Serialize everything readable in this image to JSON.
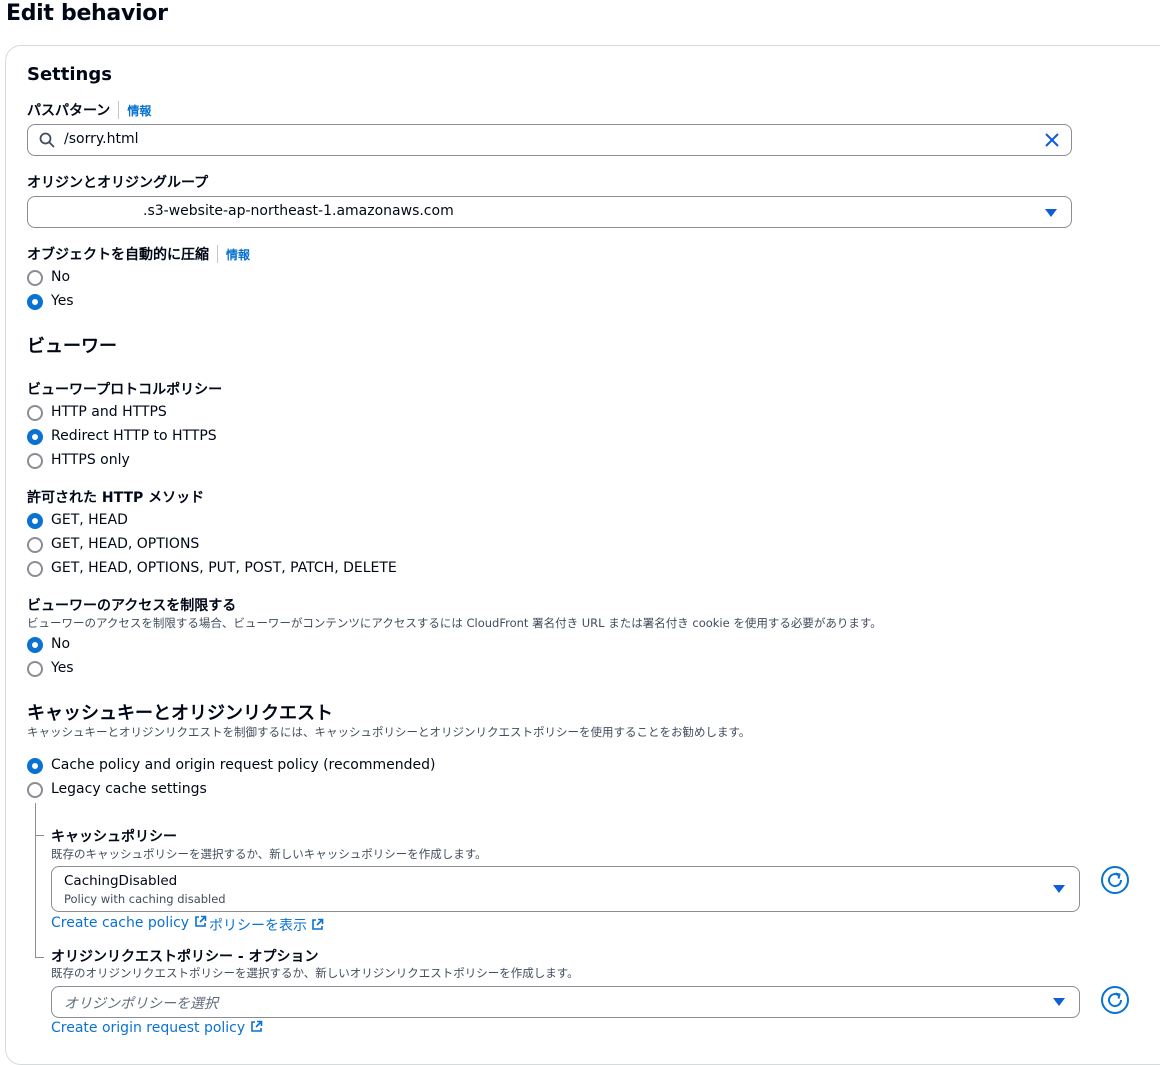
{
  "page_title": "Edit behavior",
  "settings": {
    "heading": "Settings",
    "path_pattern": {
      "label": "パスパターン",
      "info": "情報",
      "value": "/sorry.html"
    },
    "origin": {
      "label": "オリジンとオリジングループ",
      "value": ".s3-website-ap-northeast-1.amazonaws.com"
    },
    "compress": {
      "label": "オブジェクトを自動的に圧縮",
      "info": "情報",
      "options": [
        "No",
        "Yes"
      ],
      "selected": "Yes"
    }
  },
  "viewer": {
    "heading": "ビューワー",
    "protocol_policy": {
      "label": "ビューワープロトコルポリシー",
      "options": [
        "HTTP and HTTPS",
        "Redirect HTTP to HTTPS",
        "HTTPS only"
      ],
      "selected": "Redirect HTTP to HTTPS"
    },
    "http_methods": {
      "label": "許可された HTTP メソッド",
      "options": [
        "GET, HEAD",
        "GET, HEAD, OPTIONS",
        "GET, HEAD, OPTIONS, PUT, POST, PATCH, DELETE"
      ],
      "selected": "GET, HEAD"
    },
    "restrict_access": {
      "label": "ビューワーのアクセスを制限する",
      "description": "ビューワーのアクセスを制限する場合、ビューワーがコンテンツにアクセスするには CloudFront 署名付き URL または署名付き cookie を使用する必要があります。",
      "options": [
        "No",
        "Yes"
      ],
      "selected": "No"
    }
  },
  "cache": {
    "heading": "キャッシュキーとオリジンリクエスト",
    "description": "キャッシュキーとオリジンリクエストを制御するには、キャッシュポリシーとオリジンリクエストポリシーを使用することをお勧めします。",
    "options": [
      "Cache policy and origin request policy (recommended)",
      "Legacy cache settings"
    ],
    "selected": "Cache policy and origin request policy (recommended)",
    "cache_policy": {
      "label": "キャッシュポリシー",
      "description": "既存のキャッシュポリシーを選択するか、新しいキャッシュポリシーを作成します。",
      "selected_value": "CachingDisabled",
      "selected_description": "Policy with caching disabled",
      "create_link": "Create cache policy",
      "view_link": "ポリシーを表示"
    },
    "origin_request_policy": {
      "label": "オリジンリクエストポリシー - オプション",
      "description": "既存のオリジンリクエストポリシーを選択するか、新しいオリジンリクエストポリシーを作成します。",
      "placeholder": "オリジンポリシーを選択",
      "create_link": "Create origin request policy"
    }
  },
  "colors": {
    "accent": "#0972d3",
    "text": "#000716",
    "border": "#8c8c94"
  }
}
